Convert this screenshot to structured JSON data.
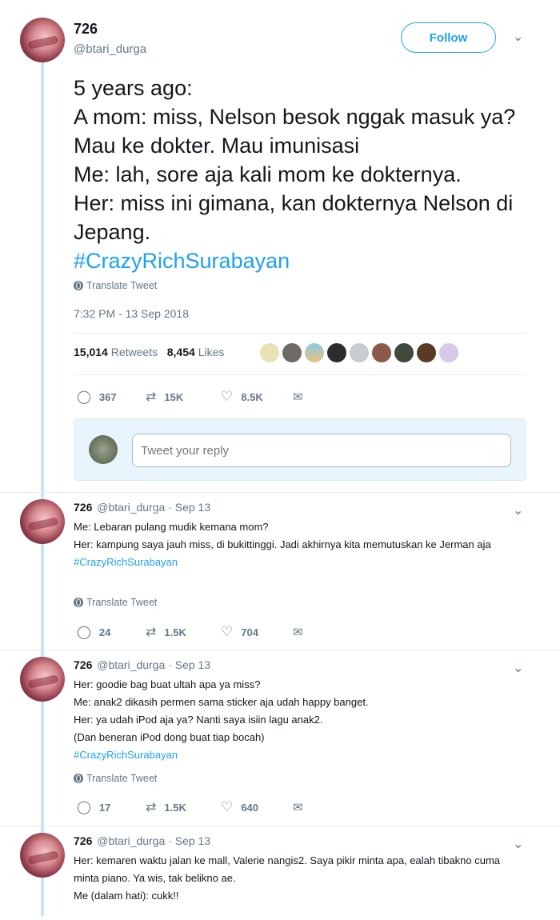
{
  "main_tweet": {
    "name": "726",
    "handle": "@btari_durga",
    "follow_label": "Follow",
    "text": "5 years ago:\nA mom: miss, Nelson besok nggak masuk ya? Mau ke dokter. Mau imunisasi\nMe: lah, sore aja kali mom ke dokternya.\nHer: miss ini gimana, kan dokternya Nelson di Jepang.",
    "hashtag": "#CrazyRichSurabayan",
    "translate_label": "Translate Tweet",
    "timestamp": "7:32 PM - 13 Sep 2018",
    "retweets_count": "15,014",
    "retweets_label": "Retweets",
    "likes_count": "8,454",
    "likes_label": "Likes",
    "actions": {
      "replies": "367",
      "retweets": "15K",
      "likes": "8.5K"
    }
  },
  "reply_box": {
    "placeholder": "Tweet your reply"
  },
  "replies": [
    {
      "name": "726",
      "meta": "@btari_durga · Sep 13",
      "text": "Me: Lebaran pulang mudik kemana mom?\nHer: kampung saya jauh miss, di bukittinggi. Jadi akhirnya kita memutuskan ke Jerman aja",
      "hashtag": "#CrazyRichSurabayan",
      "translate_label": "Translate Tweet",
      "actions": {
        "replies": "24",
        "retweets": "1.5K",
        "likes": "704"
      }
    },
    {
      "name": "726",
      "meta": "@btari_durga · Sep 13",
      "text": "Her: goodie bag buat ultah apa ya miss?\nMe: anak2 dikasih permen sama sticker aja udah happy banget.\nHer: ya udah iPod aja ya? Nanti saya isiin lagu anak2.\n(Dan beneran iPod dong buat tiap bocah)",
      "hashtag": "#CrazyRichSurabayan",
      "translate_label": "Translate Tweet",
      "actions": {
        "replies": "17",
        "retweets": "1.5K",
        "likes": "640"
      }
    },
    {
      "name": "726",
      "meta": "@btari_durga · Sep 13",
      "text": "Her: kemaren waktu jalan ke mall, Valerie nangis2. Saya pikir minta apa, ealah tibakno cuma minta piano. Ya wis, tak belikno ae.\nMe (dalam hati): cukk!!"
    }
  ],
  "icons": {
    "reply": "reply-icon",
    "retweet": "retweet-icon",
    "like": "heart-icon",
    "dm": "envelope-icon",
    "caret": "chevron-down-icon",
    "translate": "globe-icon"
  },
  "colors": {
    "accent": "#1da1f2",
    "thread_line": "#c4e5f5",
    "muted_text": "#657786",
    "reply_box_bg": "#e8f5fd"
  }
}
